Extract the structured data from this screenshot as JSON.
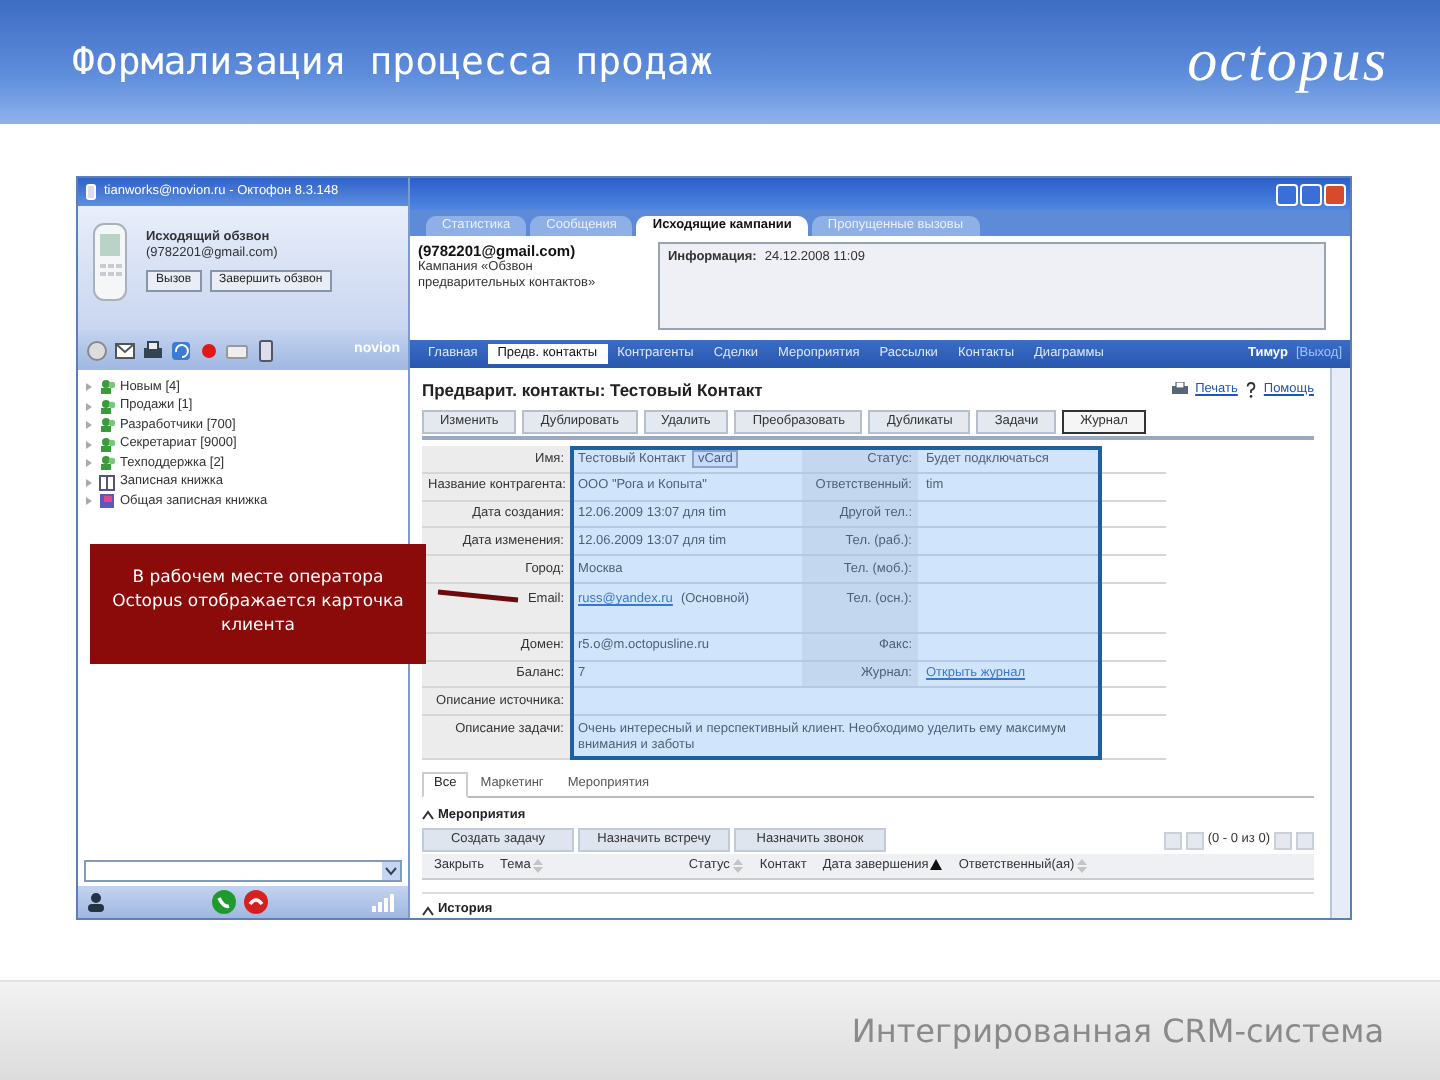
{
  "slide": {
    "title": "Формализация процесса продаж",
    "logo": "octopus",
    "footer": "Интегрированная CRM-система"
  },
  "callout": {
    "text": "В рабочем месте оператора Octopus отображается карточка клиента"
  },
  "phone": {
    "title": "tianworks@novion.ru - Октофон 8.3.148",
    "call_type": "Исходящий обзвон",
    "contact": "(9782201@gmail.com)",
    "buttons": [
      "Вызов",
      "Завершить обзвон"
    ],
    "brand": "novion",
    "tree": [
      {
        "label": "Новым [4]",
        "kind": "group"
      },
      {
        "label": "Продажи [1]",
        "kind": "group"
      },
      {
        "label": "Разработчики [700]",
        "kind": "group"
      },
      {
        "label": "Секретариат [9000]",
        "kind": "group"
      },
      {
        "label": "Техподдержка [2]",
        "kind": "group"
      },
      {
        "label": "Записная книжка",
        "kind": "book"
      },
      {
        "label": "Общая записная книжка",
        "kind": "shared"
      }
    ]
  },
  "crm": {
    "tabs": [
      {
        "label": "Статистика",
        "selected": false
      },
      {
        "label": "Сообщения",
        "selected": false
      },
      {
        "label": "Исходящие кампании",
        "selected": true
      },
      {
        "label": "Пропущенные вызовы",
        "selected": false
      }
    ],
    "contact": {
      "email": "(9782201@gmail.com)",
      "campaign": "Кампания «Обзвон",
      "campaign_2": "предварительных контактов»"
    },
    "info": {
      "label": "Информация:",
      "value": "24.12.2008 11:09"
    },
    "nav": [
      {
        "label": "Главная",
        "selected": false
      },
      {
        "label": "Предв. контакты",
        "selected": true
      },
      {
        "label": "Контрагенты",
        "selected": false
      },
      {
        "label": "Сделки",
        "selected": false
      },
      {
        "label": "Мероприятия",
        "selected": false
      },
      {
        "label": "Рассылки",
        "selected": false
      },
      {
        "label": "Контакты",
        "selected": false
      },
      {
        "label": "Диаграммы",
        "selected": false
      }
    ],
    "user": {
      "name": "Тимур",
      "logout": "[Выход]"
    },
    "heading": "Предварит. контакты: Тестовый Контакт",
    "print": "Печать",
    "help": "Помощь",
    "actions": [
      {
        "label": "Изменить",
        "selected": false
      },
      {
        "label": "Дублировать",
        "selected": false
      },
      {
        "label": "Удалить",
        "selected": false
      },
      {
        "label": "Преобразовать",
        "selected": false
      },
      {
        "label": "Дубликаты",
        "selected": false
      },
      {
        "label": "Задачи",
        "selected": false
      },
      {
        "label": "Журнал",
        "selected": true
      }
    ],
    "fields": [
      {
        "kind": "pair",
        "cells": [
          {
            "label": "Имя:",
            "value": "Тестовый Контакт",
            "tag": "vCard"
          },
          {
            "label": "Статус:",
            "value": "Будет подключаться"
          }
        ]
      },
      {
        "kind": "pair",
        "cells": [
          {
            "label": "Название контрагента:",
            "value": "ООО \"Рога и Копыта\""
          },
          {
            "label": "Ответственный:",
            "value": "tim"
          }
        ]
      },
      {
        "kind": "pair",
        "cells": [
          {
            "label": "Дата создания:",
            "value": "12.06.2009 13:07 для tim"
          },
          {
            "label": "Другой тел.:"
          }
        ]
      },
      {
        "kind": "pair",
        "cells": [
          {
            "label": "Дата изменения:",
            "value": "12.06.2009 13:07 для tim"
          },
          {
            "label": "Тел. (раб.):"
          }
        ]
      },
      {
        "kind": "pair",
        "cells": [
          {
            "label": "Город:",
            "value": "Москва"
          },
          {
            "label": "Тел. (моб.):"
          }
        ]
      },
      {
        "kind": "tall",
        "cells": [
          {
            "label": "Email:",
            "value": "russ@yandex.ru",
            "link": true,
            "note": "(Основной)"
          },
          {
            "label": "Тел. (осн.):"
          }
        ]
      },
      {
        "kind": "pair",
        "cells": [
          {
            "label": "Домен:",
            "value": "r5.o@m.octopusline.ru"
          },
          {
            "label": "Факс:"
          }
        ]
      },
      {
        "kind": "pair",
        "cells": [
          {
            "label": "Баланс:",
            "value": "7"
          },
          {
            "label": "Журнал:",
            "value": "Открыть журнал",
            "link": true
          }
        ]
      },
      {
        "kind": "wide",
        "cells": [
          {
            "label": "Описание источника:"
          }
        ]
      },
      {
        "kind": "wide",
        "cells": [
          {
            "label": "Описание задачи:",
            "value": "Очень интересный и перспективный клиент. Необходимо уделить ему максимум внимания и заботы"
          }
        ]
      }
    ],
    "subtabs": [
      {
        "label": "Все",
        "selected": true
      },
      {
        "label": "Маркетинг",
        "selected": false
      },
      {
        "label": "Мероприятия",
        "selected": false
      }
    ],
    "events": {
      "title": "Мероприятия",
      "expanded": true,
      "buttons": [
        "Создать задачу",
        "Назначить встречу",
        "Назначить звонок"
      ],
      "pager": "(0 - 0 из 0)",
      "columns": [
        {
          "label": "Закрыть",
          "sortable": false,
          "sorted": false
        },
        {
          "label": "Тема",
          "sortable": true,
          "sorted": false
        },
        {
          "label": "Статус",
          "sortable": true,
          "sorted": false
        },
        {
          "label": "Контакт",
          "sortable": false,
          "sorted": false
        },
        {
          "label": "Дата завершения",
          "sortable": true,
          "sorted": true
        },
        {
          "label": "Ответственный(ая)",
          "sortable": true,
          "sorted": false
        }
      ]
    },
    "history": {
      "title": "История",
      "expanded": true
    }
  }
}
